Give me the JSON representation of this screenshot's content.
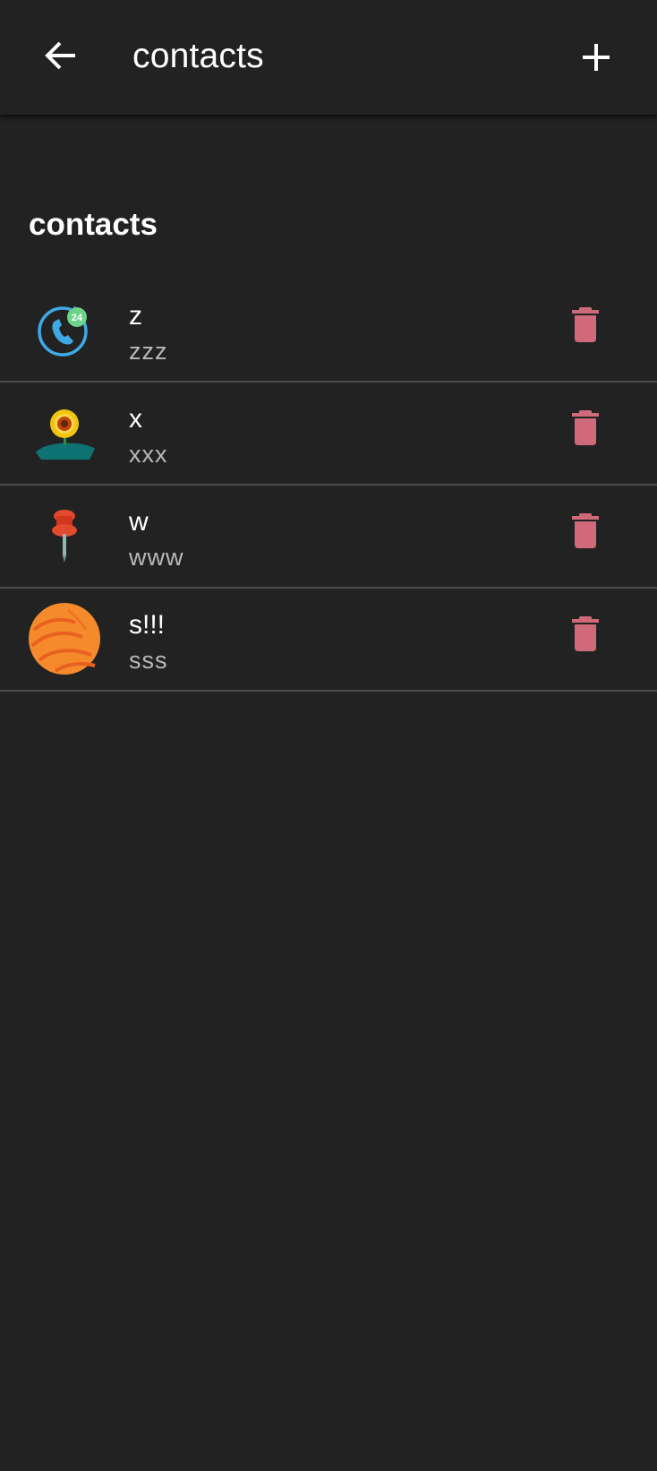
{
  "appbar": {
    "title": "contacts",
    "back_icon": "arrow-left-icon",
    "add_icon": "plus-icon"
  },
  "section": {
    "title": "contacts"
  },
  "contacts": [
    {
      "name": "z",
      "detail": "zzz",
      "avatar": "phone-24-icon"
    },
    {
      "name": "x",
      "detail": "xxx",
      "avatar": "sunflower-icon"
    },
    {
      "name": "w",
      "detail": "www",
      "avatar": "pushpin-icon"
    },
    {
      "name": "s!!!",
      "detail": "sss",
      "avatar": "orange-ball-icon"
    }
  ],
  "delete_icon": "trash-icon",
  "colors": {
    "background": "#222222",
    "text": "#ffffff",
    "subtext": "#b9b9b9",
    "divider": "#4a4a4a",
    "delete": "#d06a7a"
  }
}
